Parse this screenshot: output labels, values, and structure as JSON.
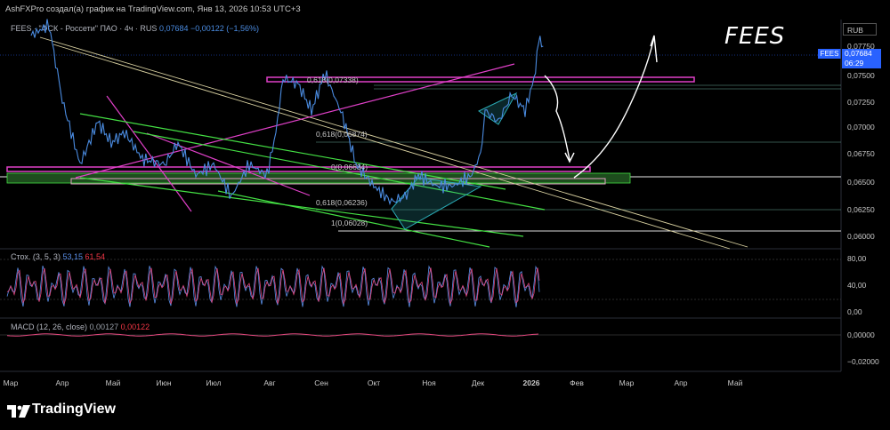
{
  "header": {
    "title": "AshFXPro создал(а) график на TradingView.com, Янв 13, 2026 10:53 UTC+3"
  },
  "legend": {
    "symbol": "FEES · \"ФСК - Россети\" ПАО · 4ч · RUS",
    "last": "0,07684",
    "change": "−0,00122 (−1,56%)"
  },
  "annotation": "FEES",
  "price_scale": {
    "currency": "RUB",
    "tag_symbol": "FEES",
    "current_price": "0,07684",
    "countdown": "06:29",
    "ticks": [
      "0,07750",
      "0,07500",
      "0,07250",
      "0,07000",
      "0,06750",
      "0,06500",
      "0,06250",
      "0,06000"
    ]
  },
  "fib_labels": [
    {
      "text": "0,618(0,07338)"
    },
    {
      "text": "0,618(0,06874)"
    },
    {
      "text": "0(0,06634)"
    },
    {
      "text": "0,618(0,06236)"
    },
    {
      "text": "1(0,06028)"
    }
  ],
  "stoch": {
    "name": "Стох. (3, 5, 3)",
    "k": "53,15",
    "d": "61,54",
    "ticks": [
      "80,00",
      "40,00",
      "0,00"
    ]
  },
  "macd": {
    "name": "MACD (12, 26, close)",
    "v1": "0,00127",
    "v2": "0,00122",
    "ticks": [
      "0,00000",
      "−0,02000"
    ]
  },
  "time_axis": [
    "Мар",
    "Апр",
    "Май",
    "Июн",
    "Июл",
    "Авг",
    "Сен",
    "Окт",
    "Ноя",
    "Дек",
    "2026",
    "Фев",
    "Мар",
    "Апр",
    "Май"
  ],
  "brand": "TradingView",
  "colors": {
    "price_line": "#4a8be0",
    "stoch_k": "#5a8fe8",
    "stoch_d": "#e0467c",
    "magenta": "#e040c8",
    "green": "#44e044",
    "background": "#000000"
  },
  "chart_data": [
    {
      "type": "line",
      "title": "FEES · \"ФСК - Россети\" ПАО · 4ч · RUS",
      "x_labels": [
        "Мар",
        "Апр",
        "Май",
        "Июн",
        "Июл",
        "Авг",
        "Сен",
        "Окт",
        "Ноя",
        "Дек",
        "2026",
        "Фев",
        "Мар",
        "Апр",
        "Май"
      ],
      "ylim": [
        0.0593,
        0.078
      ],
      "series": [
        {
          "name": "FEES",
          "x": [
            "Мар",
            "Апр",
            "Май",
            "Июн",
            "Июл",
            "Авг",
            "Сен",
            "Окт",
            "Ноя",
            "Дек",
            "2026"
          ],
          "values": [
            0.078,
            0.0705,
            0.0685,
            0.066,
            0.065,
            0.0735,
            0.073,
            0.0628,
            0.0635,
            0.066,
            0.0768
          ]
        }
      ]
    },
    {
      "type": "line",
      "title": "Стох. (3, 5, 3)",
      "ylim": [
        0,
        100
      ],
      "series": [
        {
          "name": "K",
          "last": 53.15
        },
        {
          "name": "D",
          "last": 61.54
        }
      ]
    },
    {
      "type": "line",
      "title": "MACD (12, 26, close)",
      "ylim": [
        -0.025,
        0.005
      ],
      "series": [
        {
          "name": "MACD",
          "last": 0.00127
        },
        {
          "name": "Signal",
          "last": 0.00122
        }
      ]
    }
  ]
}
